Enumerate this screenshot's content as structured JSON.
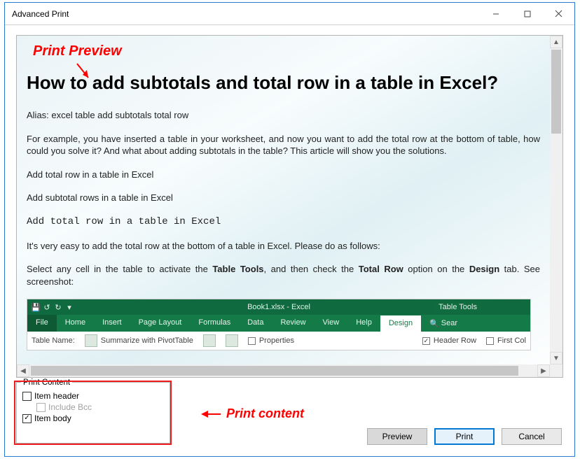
{
  "window": {
    "title": "Advanced Print"
  },
  "annotations": {
    "preview_label": "Print Preview",
    "content_label": "Print content"
  },
  "preview": {
    "heading": "How to add subtotals and total row in a table in Excel?",
    "alias": "Alias: excel table add subtotals total row",
    "para1_a": "For example, you have inserted a table in your worksheet, and now you want to add the total row at the bottom of table, how could you solve it? And what about adding subtotals in the table? This article will show you the solutions.",
    "link1": "Add total row in a table in Excel",
    "link2": "Add subtotal rows in a table in Excel",
    "sub1": "Add total row in a table in Excel",
    "para2": "It's very easy to add the total row at the bottom of a table in Excel. Please do as follows:",
    "para3_a": "Select any cell in the table to activate the ",
    "para3_b": "Table Tools",
    "para3_c": ", and then check the ",
    "para3_d": "Total Row",
    "para3_e": " option on the ",
    "para3_f": "Design",
    "para3_g": " tab. See screenshot:",
    "ribbon": {
      "center": "Book1.xlsx - Excel",
      "tabletools": "Table Tools",
      "tabs": {
        "file": "File",
        "home": "Home",
        "insert": "Insert",
        "pagelayout": "Page Layout",
        "formulas": "Formulas",
        "data": "Data",
        "review": "Review",
        "view": "View",
        "help": "Help",
        "design": "Design",
        "search": "Sear"
      },
      "row3": {
        "tablename": "Table Name:",
        "summarize": "Summarize with PivotTable",
        "properties": "Properties",
        "headerrow": "Header Row",
        "firstcol": "First Col"
      }
    }
  },
  "print_content": {
    "legend": "Print Content",
    "item_header": "Item header",
    "include_bcc": "Include Bcc",
    "item_body": "Item body",
    "item_header_checked": false,
    "include_bcc_checked": false,
    "item_body_checked": true
  },
  "buttons": {
    "preview": "Preview",
    "print": "Print",
    "cancel": "Cancel"
  }
}
